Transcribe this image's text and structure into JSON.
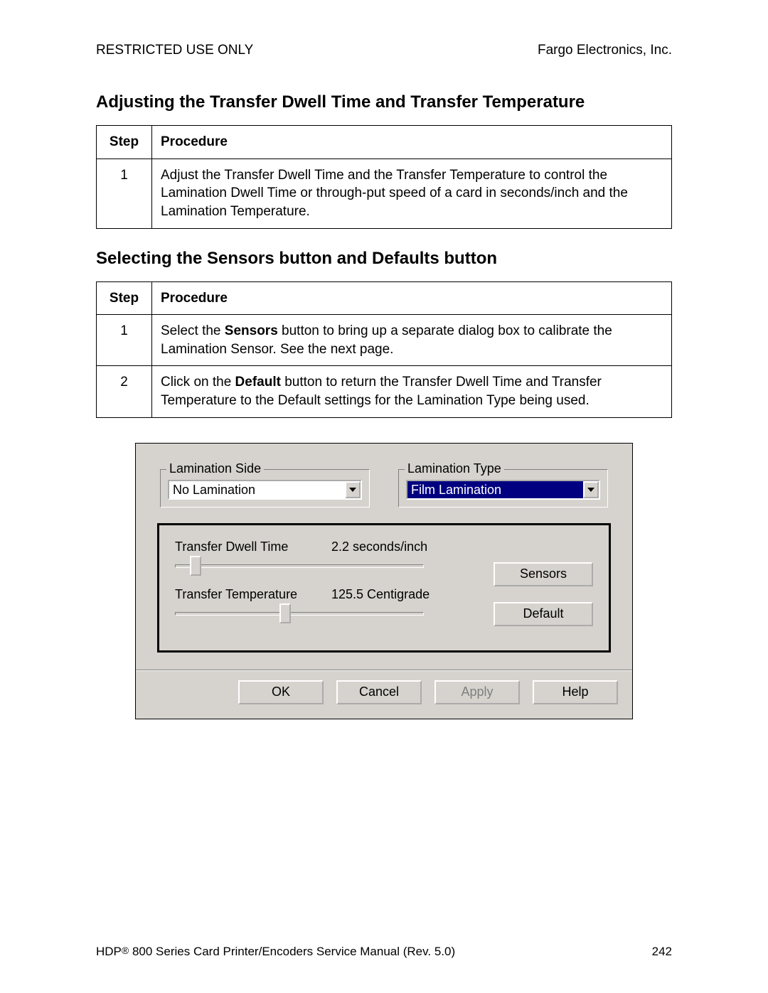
{
  "header": {
    "left": "RESTRICTED USE ONLY",
    "right": "Fargo Electronics, Inc."
  },
  "heading1": "Adjusting the Transfer Dwell Time and Transfer Temperature",
  "table1": {
    "cols": {
      "step": "Step",
      "procedure": "Procedure"
    },
    "rows": [
      {
        "step": "1",
        "text": "Adjust the Transfer Dwell Time and the Transfer Temperature to control the Lamination Dwell Time or through-put speed of a card in seconds/inch  and the Lamination Temperature."
      }
    ]
  },
  "heading2": "Selecting the Sensors button and Defaults button",
  "table2": {
    "cols": {
      "step": "Step",
      "procedure": "Procedure"
    },
    "rows": [
      {
        "step": "1",
        "pre": "Select the ",
        "bold": "Sensors",
        "post": " button to bring up a separate dialog box to calibrate the Lamination Sensor. See the next page."
      },
      {
        "step": "2",
        "pre": "Click on the ",
        "bold": "Default",
        "post": " button to return the Transfer Dwell Time and Transfer Temperature to the Default settings for the Lamination Type being used."
      }
    ]
  },
  "dialog": {
    "groups": {
      "lamination_side": {
        "legend": "Lamination Side",
        "value": "No Lamination",
        "selected": false
      },
      "lamination_type": {
        "legend": "Lamination Type",
        "value": "Film Lamination",
        "selected": true
      }
    },
    "sliders": {
      "dwell": {
        "label": "Transfer Dwell Time",
        "value": "2.2  seconds/inch",
        "thumb_pct": 6
      },
      "temp": {
        "label": "Transfer Temperature",
        "value": "125.5  Centigrade",
        "thumb_pct": 42
      }
    },
    "side_buttons": {
      "sensors": "Sensors",
      "default": "Default"
    },
    "bottom_buttons": {
      "ok": "OK",
      "cancel": "Cancel",
      "apply": "Apply",
      "help": "Help"
    }
  },
  "footer": {
    "left_pre": "HDP",
    "reg": "®",
    "left_post": " 800 Series Card Printer/Encoders Service Manual (Rev. 5.0)",
    "page": "242"
  }
}
